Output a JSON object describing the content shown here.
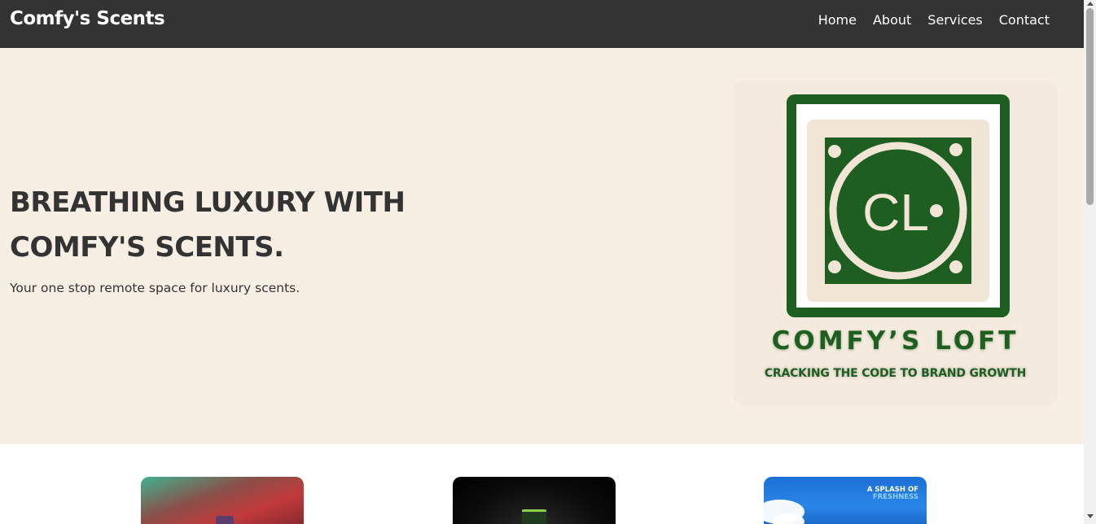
{
  "header": {
    "brand": "Comfy's Scents",
    "nav": [
      "Home",
      "About",
      "Services",
      "Contact"
    ],
    "background": "#333333"
  },
  "hero": {
    "title_line1": "BREATHING LUXURY WITH",
    "title_line2": "COMFY'S SCENTS.",
    "subtitle": "Your one stop remote space for luxury scents.",
    "background": "#f8efe4",
    "logo": {
      "monogram": "CL",
      "name": "COMFY’S LOFT",
      "tagline": "CRACKING THE CODE TO BRAND GROWTH",
      "color": "#1e5e20"
    }
  },
  "products": {
    "promo_line1": "A SPLASH OF",
    "promo_line2": "FRESHNESS"
  }
}
